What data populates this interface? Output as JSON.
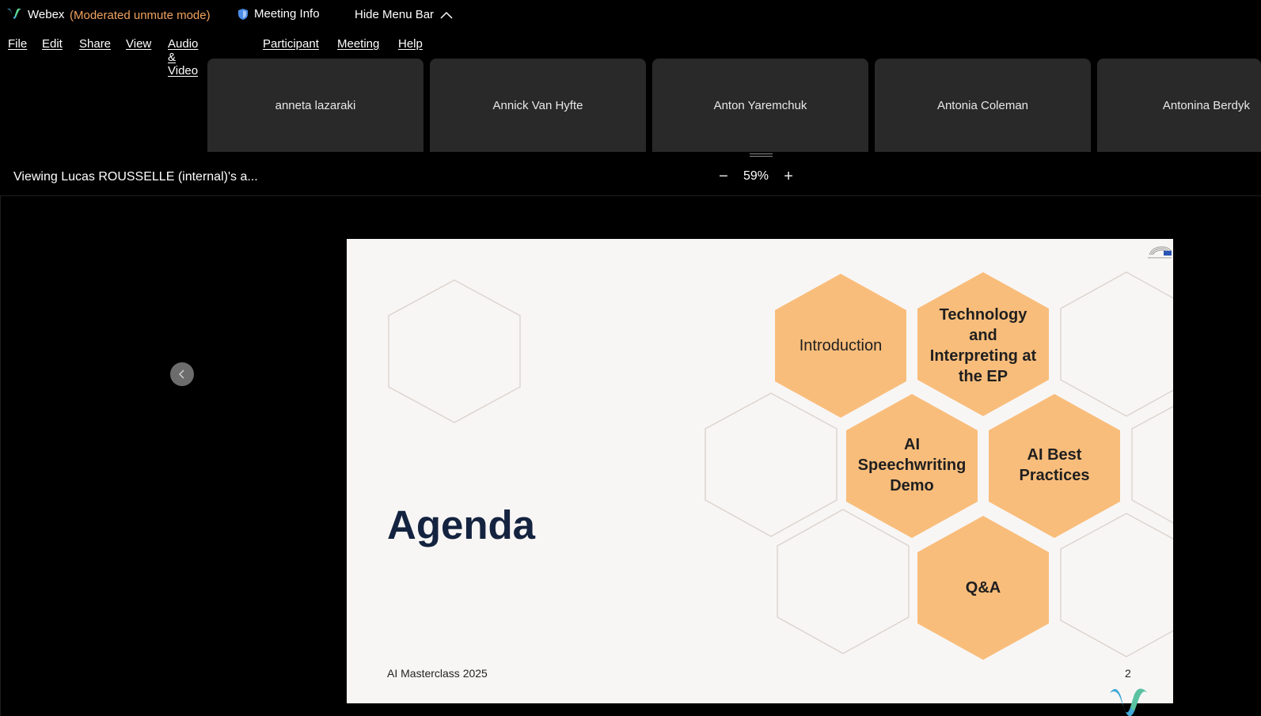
{
  "titlebar": {
    "app_name": "Webex",
    "mode": "(Moderated unmute mode)",
    "meeting_info": "Meeting Info",
    "hide_menu_bar": "Hide Menu Bar"
  },
  "menu": [
    "File",
    "Edit",
    "Share",
    "View",
    "Audio & Video",
    "Participant",
    "Meeting",
    "Help"
  ],
  "participants": [
    "anneta lazaraki",
    "Annick Van Hyfte",
    "Anton Yaremchuk",
    "Antonia Coleman",
    "Antonina Berdyk"
  ],
  "viewing": "Viewing Lucas ROUSSELLE (internal)'s a...",
  "zoom": {
    "value": "59%",
    "minus": "−",
    "plus": "+"
  },
  "slide": {
    "title": "Agenda",
    "footer": "AI Masterclass 2025",
    "page_number": "2",
    "topics": {
      "introduction": "Introduction",
      "technology": [
        "Technology",
        "and",
        "Interpreting at",
        "the EP"
      ],
      "speechwriting": [
        "AI",
        "Speechwriting",
        "Demo"
      ],
      "best_practices": [
        "AI Best",
        "Practices"
      ],
      "qa": "Q&A"
    }
  },
  "colors": {
    "accent_orange": "#f0a35e",
    "hex_fill": "#f9bd7b",
    "slide_bg": "#f8f6f5",
    "title_navy": "#14233f"
  }
}
